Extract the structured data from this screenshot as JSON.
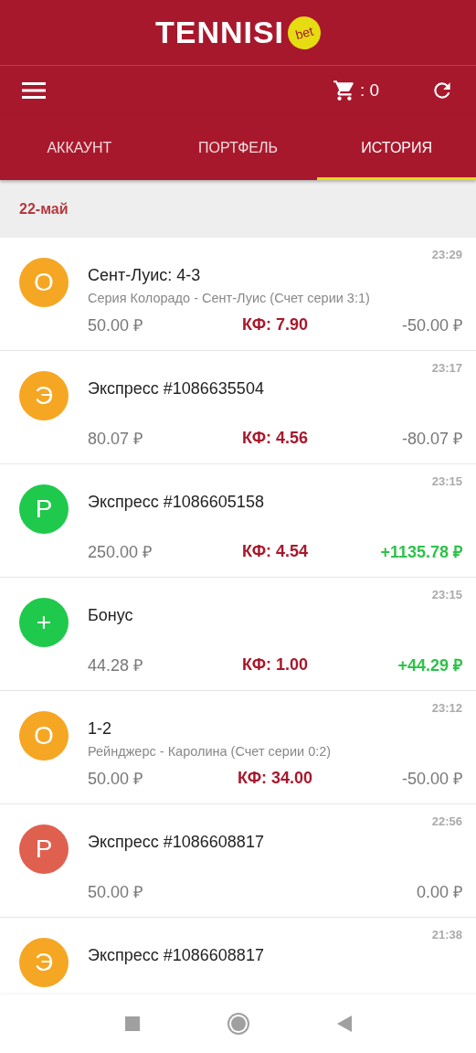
{
  "header": {
    "logo": "TENNISI",
    "logo_badge": "bet"
  },
  "toolbar": {
    "cart_count": ": 0"
  },
  "tabs": [
    {
      "label": "АККАУНТ",
      "selected": false
    },
    {
      "label": "ПОРТФЕЛЬ",
      "selected": false
    },
    {
      "label": "ИСТОРИЯ",
      "selected": true
    }
  ],
  "date": "22-май",
  "bets": [
    {
      "letter": "О",
      "color": "#f5a623",
      "time": "23:29",
      "title": "Сент-Луис: 4-3",
      "subtitle": "Серия Колорадо - Сент-Луис (Счет серии 3:1)",
      "stake": "50.00 ₽",
      "odds": "КФ: 7.90",
      "result": "-50.00 ₽",
      "won": false
    },
    {
      "letter": "Э",
      "color": "#f5a623",
      "time": "23:17",
      "title": "Экспресс #1086635504",
      "stake": "80.07 ₽",
      "odds": "КФ: 4.56",
      "result": "-80.07 ₽",
      "won": false
    },
    {
      "letter": "Р",
      "color": "#1fc94b",
      "time": "23:15",
      "title": "Экспресс #1086605158",
      "stake": "250.00 ₽",
      "odds": "КФ: 4.54",
      "result": "+1135.78 ₽",
      "won": true
    },
    {
      "letter": "+",
      "color": "#1fc94b",
      "time": "23:15",
      "title": "Бонус",
      "stake": "44.28 ₽",
      "odds": "КФ: 1.00",
      "result": "+44.29 ₽",
      "won": true
    },
    {
      "letter": "О",
      "color": "#f5a623",
      "time": "23:12",
      "title": "1-2",
      "subtitle": "Рейнджерс - Каролина (Счет серии 0:2)",
      "stake": "50.00 ₽",
      "odds": "КФ: 34.00",
      "result": "-50.00 ₽",
      "won": false
    },
    {
      "letter": "Р",
      "color": "#e0604f",
      "time": "22:56",
      "title": "Экспресс #1086608817",
      "stake": "50.00 ₽",
      "result": "0.00 ₽",
      "won": false
    },
    {
      "letter": "Э",
      "color": "#f5a623",
      "time": "21:38",
      "title": "Экспресс #1086608817"
    }
  ]
}
